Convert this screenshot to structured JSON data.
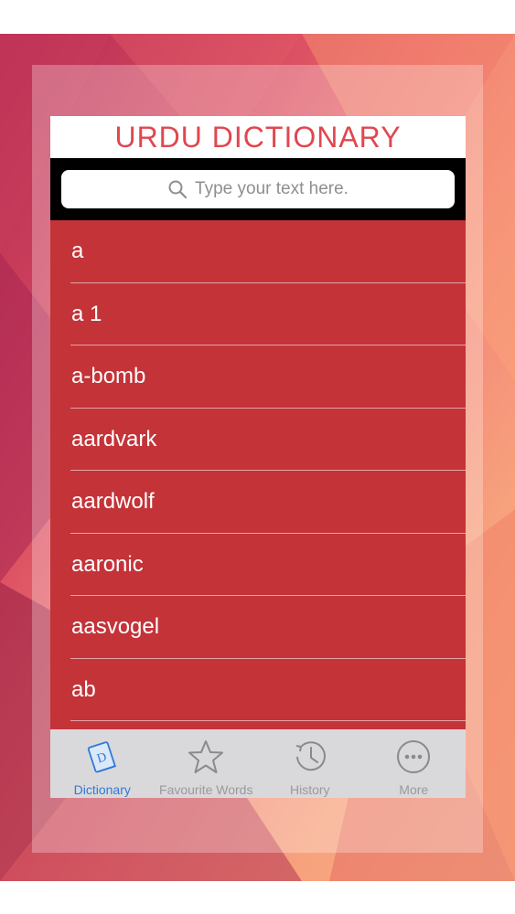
{
  "app": {
    "title": "URDU DICTIONARY",
    "accent_color": "#e0474f",
    "list_color": "#c33338"
  },
  "search": {
    "placeholder": "Type your text here.",
    "icon": "search-icon"
  },
  "words": [
    "a",
    "a 1",
    "a-bomb",
    "aardvark",
    "aardwolf",
    "aaronic",
    "aasvogel",
    "ab"
  ],
  "tabs": [
    {
      "label": "Dictionary",
      "icon": "dictionary-book-icon",
      "active": true
    },
    {
      "label": "Favourite Words",
      "icon": "star-icon",
      "active": false
    },
    {
      "label": "History",
      "icon": "history-clock-icon",
      "active": false
    },
    {
      "label": "More",
      "icon": "more-dots-icon",
      "active": false
    }
  ]
}
